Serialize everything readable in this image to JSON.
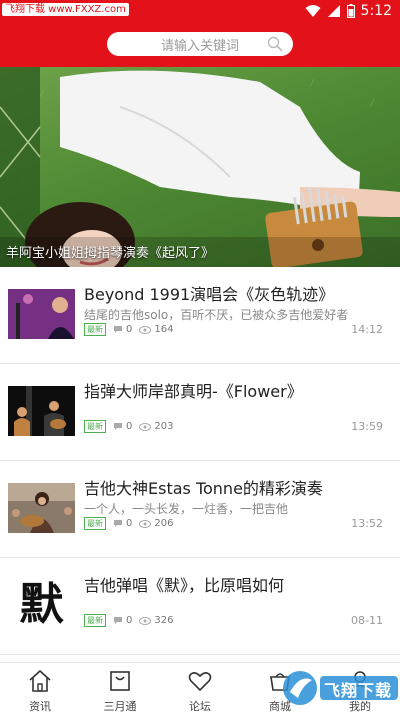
{
  "status": {
    "watermark": "飞翔下载 www.FXXZ.com",
    "time": "5:12"
  },
  "search": {
    "placeholder": "请输入关键词"
  },
  "banner": {
    "caption": "羊阿宝小姐姐拇指琴演奏《起风了》"
  },
  "articles": [
    {
      "title": "Beyond 1991演唱会《灰色轨迹》",
      "desc": "结尾的吉他solo，百听不厌，已被众多吉他爱好者",
      "tag": "最新",
      "comments": "0",
      "views": "164",
      "time": "14:12",
      "thumb": "concert"
    },
    {
      "title": "指弹大师岸部真明-《Flower》",
      "desc": "",
      "tag": "最新",
      "comments": "0",
      "views": "203",
      "time": "13:59",
      "thumb": "stage"
    },
    {
      "title": "吉他大神Estas Tonne的精彩演奏",
      "desc": "一个人，一头长发，一炷香，一把吉他",
      "tag": "最新",
      "comments": "0",
      "views": "206",
      "time": "13:52",
      "thumb": "street"
    },
    {
      "title": "吉他弹唱《默》，比原唱如何",
      "desc": "",
      "tag": "最新",
      "comments": "0",
      "views": "326",
      "time": "08-11",
      "thumb": "calligraphy",
      "thumb_text": "默"
    }
  ],
  "tabs": [
    {
      "label": "资讯",
      "icon": "home-icon"
    },
    {
      "label": "三月通",
      "icon": "bag-icon"
    },
    {
      "label": "论坛",
      "icon": "heart-icon"
    },
    {
      "label": "商城",
      "icon": "shop-icon"
    },
    {
      "label": "我的",
      "icon": "user-icon"
    }
  ],
  "colors": {
    "brand_red": "#e3121a",
    "tag_green": "#4caf50",
    "watermark_blue": "#2a8fd6"
  },
  "watermark_logo_text": "飞翔下载"
}
